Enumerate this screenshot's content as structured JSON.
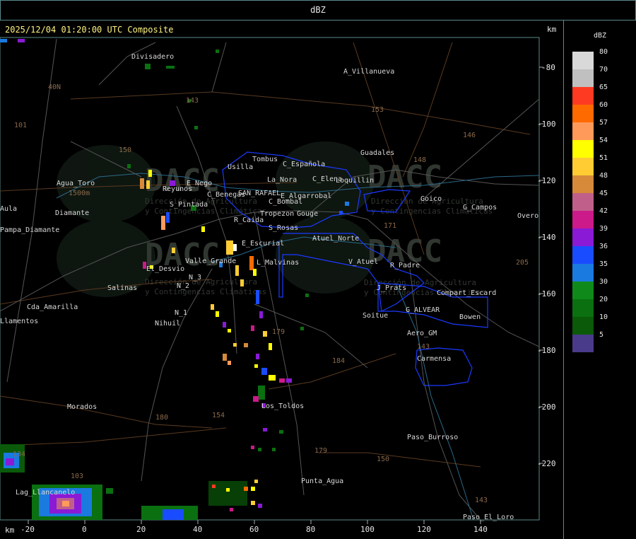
{
  "header": {
    "title": "dBZ"
  },
  "timestamp": "2025/12/04 01:20:00 UTC Composite",
  "axis": {
    "unit": "km",
    "x_ticks": [
      "-20",
      "0",
      "20",
      "40",
      "60",
      "80",
      "100",
      "120",
      "140"
    ],
    "y_ticks": [
      "-80",
      "-100",
      "-120",
      "-140",
      "-160",
      "-180",
      "-200",
      "-220"
    ]
  },
  "legend": {
    "title": "dBZ",
    "items": [
      {
        "value": "80",
        "color": "#d9d9d9"
      },
      {
        "value": "70",
        "color": "#c0c0c0"
      },
      {
        "value": "65",
        "color": "#ff3a22"
      },
      {
        "value": "60",
        "color": "#ff6a00"
      },
      {
        "value": "57",
        "color": "#ff9a5a"
      },
      {
        "value": "54",
        "color": "#ffff00"
      },
      {
        "value": "51",
        "color": "#ffcc33"
      },
      {
        "value": "48",
        "color": "#d68a3a"
      },
      {
        "value": "45",
        "color": "#c0608a"
      },
      {
        "value": "42",
        "color": "#cc1a8a"
      },
      {
        "value": "39",
        "color": "#8a1ad6"
      },
      {
        "value": "36",
        "color": "#1a4cff"
      },
      {
        "value": "35",
        "color": "#1a7ae0"
      },
      {
        "value": "30",
        "color": "#0f8a1a"
      },
      {
        "value": "20",
        "color": "#0a7010"
      },
      {
        "value": "10",
        "color": "#0a5a0a"
      },
      {
        "value": "5",
        "color": "#4a3a8a"
      }
    ]
  },
  "places": [
    "Divisadero",
    "A_Villanueva",
    "40N",
    "101",
    "153",
    "146",
    "Guadales",
    "148",
    "150",
    "143",
    "Tombus",
    "Usilla",
    "C_Española",
    "La_Nora",
    "C_Elena",
    "Loquillin",
    "Agua_Toro",
    "1500m",
    "Reyunos",
    "E_Nego",
    "C_Benegas",
    "SAN_RAFAEL",
    "E_Algarrobal",
    "Goico",
    "G_Campos",
    "Aula",
    "Overo",
    "S_Pintada",
    "C_Bombal",
    "Tropezon",
    "Gouge",
    "Pampa_Diamante",
    "Diamante",
    "R_Caida",
    "S_Rosas",
    "171",
    "Atuel_Norte",
    "E_Escurial",
    "Valle_Grande",
    "L_Malvinas",
    "V_Atuel",
    "R_Padre",
    "205",
    "El_Desvio",
    "N_3",
    "Salinas",
    "N_2",
    "J_Prats",
    "Compart_Escard",
    "Cda_Amarilla",
    "N_1",
    "G_ALVEAR",
    "Soitue",
    "Bowen",
    "Nihuil",
    "Llamentos",
    "179",
    "Aero_GM",
    "143",
    "184",
    "Carmensa",
    "Morados",
    "Los_Toldos",
    "180",
    "154",
    "179",
    "Paso_Burroso",
    "150",
    "Punta_Agua",
    "Lag_Llancanelo",
    "134",
    "103",
    "Paso_El_Loro",
    "143"
  ],
  "watermark": {
    "text": "DACC",
    "subtitle_1": "Dirección de Agricultura",
    "subtitle_2": "y Contingencias Climáticas"
  }
}
